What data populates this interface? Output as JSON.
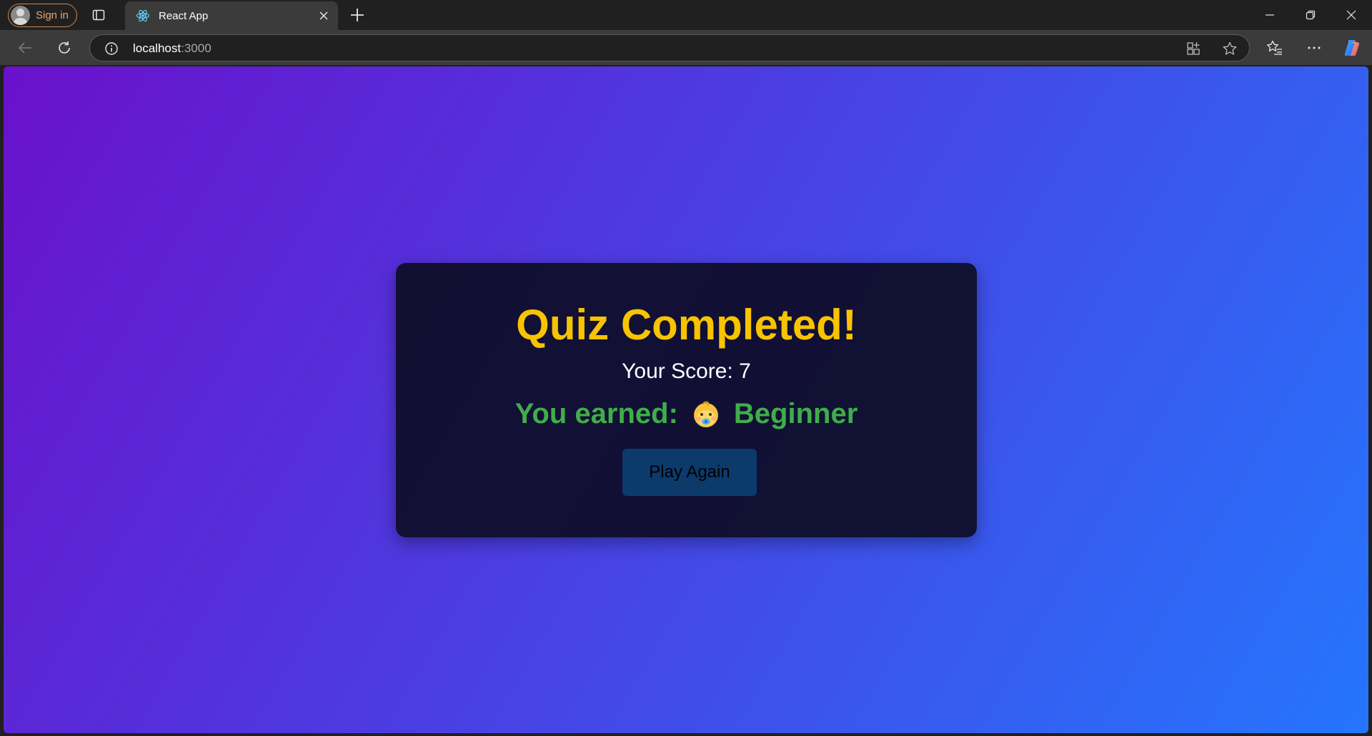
{
  "browser": {
    "profile_label": "Sign in",
    "tab_title": "React App",
    "url_host": "localhost",
    "url_port": ":3000",
    "accent": "#c98a52"
  },
  "quiz": {
    "title": "Quiz Completed!",
    "score_text": "Your Score: 7",
    "earned_prefix": "You earned:",
    "badge_icon": "baby-emoji-icon",
    "badge_label": "Beginner",
    "play_again_label": "Play Again",
    "colors": {
      "title": "#f8c300",
      "earned": "#3fae4a",
      "button": "#0b3a6b",
      "gradient_start": "#6a11cb",
      "gradient_end": "#2575fc"
    }
  }
}
